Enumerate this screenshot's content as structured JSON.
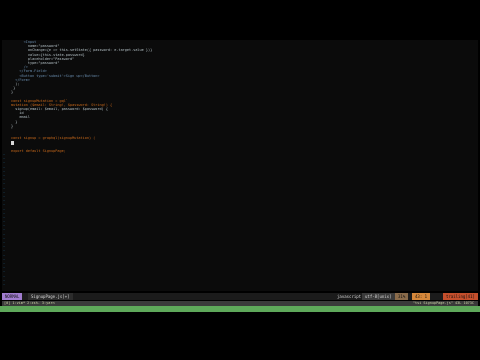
{
  "editor": {
    "lines": [
      {
        "gutter": "",
        "text": "      <Input"
      },
      {
        "gutter": "",
        "text": "        name=\"password\""
      },
      {
        "gutter": "",
        "text": "        onChange={e => this.setState({ password: e.target.value })}"
      },
      {
        "gutter": "",
        "text": "        value={this.state.password}"
      },
      {
        "gutter": "",
        "text": "        placeholder=\"Password\""
      },
      {
        "gutter": "",
        "text": "        type=\"password\""
      },
      {
        "gutter": "",
        "text": "      />"
      },
      {
        "gutter": "",
        "text": "    </Form.Field>"
      },
      {
        "gutter": "",
        "text": "    <Button type='submit'>Sign up</Button>"
      },
      {
        "gutter": "",
        "text": "  </Form>"
      },
      {
        "gutter": "",
        "text": "  );"
      },
      {
        "gutter": "",
        "text": " }"
      },
      {
        "gutter": "",
        "text": "}"
      },
      {
        "gutter": "",
        "text": ""
      },
      {
        "gutter": "",
        "text": "const signupMutation = gql`"
      },
      {
        "gutter": "",
        "text": "mutation ($email: String!, $password: String!) {"
      },
      {
        "gutter": "",
        "text": "  signup(email: $email, password: $password) {"
      },
      {
        "gutter": "",
        "text": "    id"
      },
      {
        "gutter": "",
        "text": "    email"
      },
      {
        "gutter": "",
        "text": "  }"
      },
      {
        "gutter": "",
        "text": "}"
      },
      {
        "gutter": "",
        "text": "`"
      },
      {
        "gutter": "",
        "text": ""
      },
      {
        "gutter": "",
        "text": "const signup = graphql(signupMutation) ("
      },
      {
        "gutter": "",
        "text": ""
      },
      {
        "gutter": "",
        "text": ""
      },
      {
        "gutter": "",
        "text": "export default SignupPage;"
      }
    ],
    "tilde": "~"
  },
  "statusbar": {
    "mode": "NORMAL",
    "filename": "SignupPage.js[+]",
    "filetype": "javascript",
    "encoding": "utf-8[unix]",
    "percent": "31%",
    "position": "43:  1",
    "warning": "trailing[41]"
  },
  "cmdline": {
    "left": "[0] 1:vim* 2:zsh- 3:yarn",
    "right": "\"tsi SignupPage.js\" 43L 1073C"
  },
  "greenbar": {
    "text": ""
  },
  "colors": {
    "normal_mode": "#a07ccf",
    "filename_bar": "#2c2c2c",
    "position_bg": "#d4873a",
    "warning_bg": "#c44f2c",
    "green_bar": "#5ea85a"
  }
}
